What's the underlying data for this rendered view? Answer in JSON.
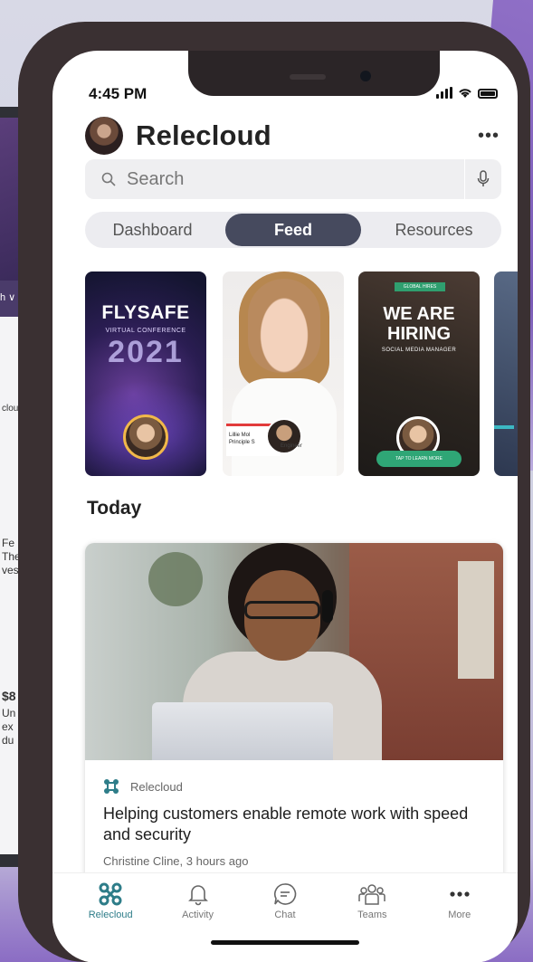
{
  "status": {
    "time": "4:45 PM"
  },
  "app": {
    "title": "Relecloud",
    "more": "•••"
  },
  "search": {
    "placeholder": "Search"
  },
  "segments": [
    {
      "label": "Dashboard",
      "active": false
    },
    {
      "label": "Feed",
      "active": true
    },
    {
      "label": "Resources",
      "active": false
    }
  ],
  "stories": {
    "flysafe": {
      "name": "FLYSAFE",
      "subtitle": "VIRTUAL CONFERENCE",
      "year": "2021"
    },
    "profile": {
      "name": "Lillie Mol",
      "role": "Principle S",
      "role_end": "Engineer"
    },
    "hiring": {
      "badge": "GLOBAL HIRES",
      "headline": "WE ARE HIRING",
      "subtitle": "SOCIAL MEDIA MANAGER",
      "cta": "TAP TO LEARN MORE"
    }
  },
  "back_phone": {
    "bar": "h ∨",
    "snippet": "clou",
    "text_lines": [
      "Fe",
      "The",
      "ves"
    ],
    "price": "$8",
    "lines2": [
      "Un",
      "ex",
      "du"
    ]
  },
  "feed": {
    "section": "Today",
    "post": {
      "source": "Relecloud",
      "headline": "Helping customers enable remote work with speed and security",
      "meta": "Christine Cline, 3 hours ago"
    }
  },
  "tabbar": [
    {
      "label": "Relecloud",
      "icon": "relecloud-icon",
      "active": true
    },
    {
      "label": "Activity",
      "icon": "bell-icon",
      "active": false
    },
    {
      "label": "Chat",
      "icon": "chat-icon",
      "active": false
    },
    {
      "label": "Teams",
      "icon": "teams-icon",
      "active": false
    },
    {
      "label": "More",
      "icon": "more-icon",
      "active": false
    }
  ],
  "colors": {
    "accent": "#464a5e",
    "teal": "#2e7d89",
    "hiring_green": "#2fa676"
  }
}
